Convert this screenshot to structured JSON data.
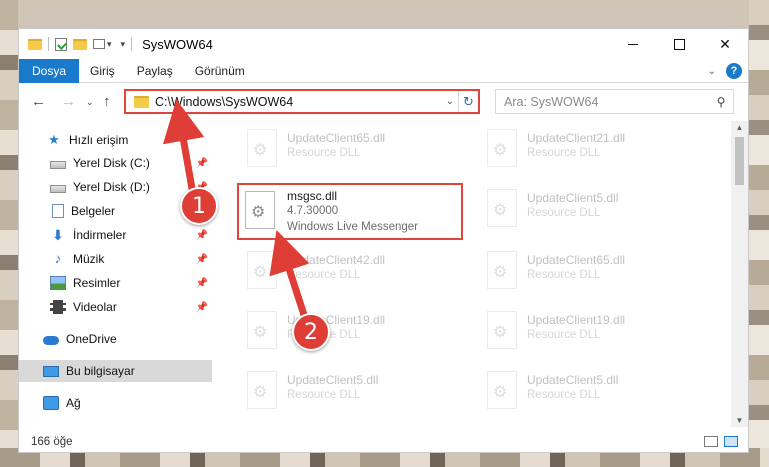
{
  "window": {
    "title": "SysWOW64"
  },
  "quick_access_toolbar": {
    "dropdown_glyph": "▾",
    "customize_glyph": "▾"
  },
  "ribbon": {
    "tabs": [
      {
        "label": "Dosya",
        "active": true
      },
      {
        "label": "Giriş",
        "active": false
      },
      {
        "label": "Paylaş",
        "active": false
      },
      {
        "label": "Görünüm",
        "active": false
      }
    ],
    "help_label": "?"
  },
  "address_bar": {
    "path": "C:\\Windows\\SysWOW64",
    "highlight_color": "#e0453b"
  },
  "search": {
    "placeholder": "Ara: SysWOW64"
  },
  "nav_pane": {
    "items": [
      {
        "label": "Hızlı erişim",
        "icon": "star-icon",
        "pinned": false,
        "selected": false
      },
      {
        "label": "Yerel Disk (C:)",
        "icon": "disk-icon",
        "pinned": true,
        "selected": false
      },
      {
        "label": "Yerel Disk (D:)",
        "icon": "disk-icon",
        "pinned": true,
        "selected": false
      },
      {
        "label": "Belgeler",
        "icon": "documents-icon",
        "pinned": true,
        "selected": false
      },
      {
        "label": "İndirmeler",
        "icon": "download-icon",
        "pinned": true,
        "selected": false
      },
      {
        "label": "Müzik",
        "icon": "music-icon",
        "pinned": true,
        "selected": false
      },
      {
        "label": "Resimler",
        "icon": "pictures-icon",
        "pinned": true,
        "selected": false
      },
      {
        "label": "Videolar",
        "icon": "videos-icon",
        "pinned": true,
        "selected": false
      },
      {
        "label": "OneDrive",
        "icon": "onedrive-icon",
        "pinned": false,
        "selected": false
      },
      {
        "label": "Bu bilgisayar",
        "icon": "this-pc-icon",
        "pinned": false,
        "selected": true
      },
      {
        "label": "Ağ",
        "icon": "network-icon",
        "pinned": false,
        "selected": false
      }
    ]
  },
  "files": {
    "left_column": [
      {
        "name": "UpdateClient65.dll",
        "desc": "Resource DLL"
      },
      {
        "name": "UpdateClient42.dll",
        "desc": "Resource DLL"
      },
      {
        "name": "UpdateClient19.dll",
        "desc": "Resource DLL"
      },
      {
        "name": "UpdateClient5.dll",
        "desc": "Resource DLL"
      }
    ],
    "right_column": [
      {
        "name": "UpdateClient21.dll",
        "desc": "Resource DLL"
      },
      {
        "name": "UpdateClient5.dll",
        "desc": "Resource DLL"
      },
      {
        "name": "UpdateClient65.dll",
        "desc": "Resource DLL"
      },
      {
        "name": "UpdateClient19.dll",
        "desc": "Resource DLL"
      },
      {
        "name": "UpdateClient5.dll",
        "desc": "Resource DLL"
      }
    ],
    "highlighted": {
      "name": "msgsc.dll",
      "version": "4.7.30000",
      "description": "Windows Live Messenger"
    }
  },
  "status_bar": {
    "item_count": "166 öğe"
  },
  "annotations": {
    "badge_1": "1",
    "badge_2": "2",
    "color": "#de3e35"
  }
}
